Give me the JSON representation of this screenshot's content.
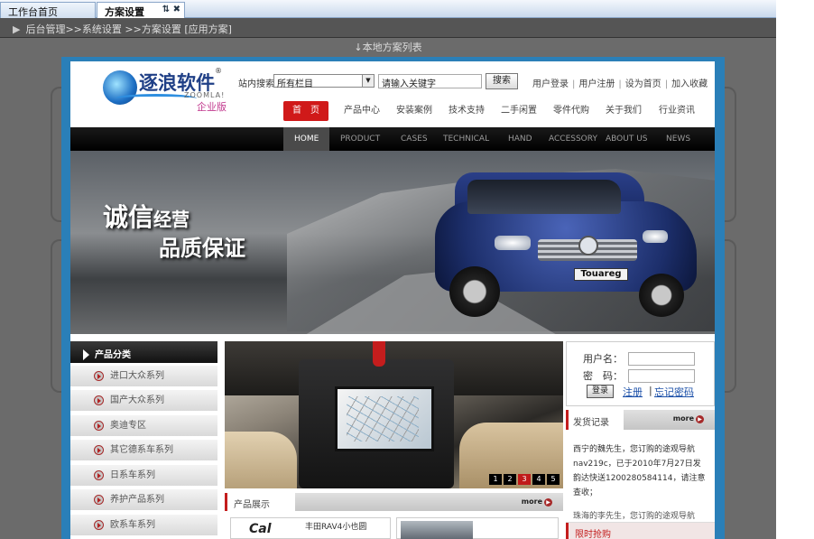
{
  "tabs": [
    {
      "label": "工作台首页"
    },
    {
      "label": "方案设置",
      "controls": "⇅ ✖"
    }
  ],
  "breadcrumb": "后台管理>>系统设置 >>方案设置 [应用方案]",
  "list_title": "↓本地方案列表",
  "site": {
    "logo": {
      "name": "逐浪软件",
      "reg": "®",
      "en": "ZOOMLA!",
      "edition": "企业版"
    },
    "search": {
      "label": "站内搜索",
      "select_value": "所有栏目",
      "input_value": "请输入关键字",
      "button": "搜索"
    },
    "toplinks": [
      "用户登录",
      "用户注册",
      "设为首页",
      "加入收藏"
    ],
    "cn_nav": [
      "首　页",
      "产品中心",
      "安装案例",
      "技术支持",
      "二手闲置",
      "零件代购",
      "关于我们",
      "行业资讯"
    ],
    "en_nav": [
      "HOME",
      "PRODUCT",
      "CASES",
      "TECHNICAL",
      "HAND",
      "ACCESSORY",
      "ABOUT US",
      "NEWS"
    ],
    "banner": {
      "slogan1a": "诚信",
      "slogan1b": "经营",
      "slogan2": "品质保证",
      "plate": "Touareg"
    },
    "categories": {
      "title": "产品分类",
      "items": [
        "进口大众系列",
        "国产大众系列",
        "奥迪专区",
        "其它德系车系列",
        "日系车系列",
        "养护产品系列",
        "欧系车系列"
      ]
    },
    "slides": [
      "1",
      "2",
      "3",
      "4",
      "5"
    ],
    "products": {
      "title": "产品展示",
      "more": "more",
      "item1_title": "丰田RAV4小也圆",
      "item1_logo": "Cal"
    },
    "login": {
      "username_label": "用户名：",
      "password_label": "密　码：",
      "login_button": "登录",
      "register_link": "注册",
      "forgot_link": "忘记密码",
      "separator": "|"
    },
    "shipping": {
      "title": "发货记录",
      "more": "more",
      "text": "西宁的魏先生，您订购的途观导航nav219c，已于2010年7月27日发韵达快送1200280584114，请注意查收；",
      "text2": "珠海的李先生，您订购的途观导航"
    },
    "flash_sale": "限时抢购"
  }
}
